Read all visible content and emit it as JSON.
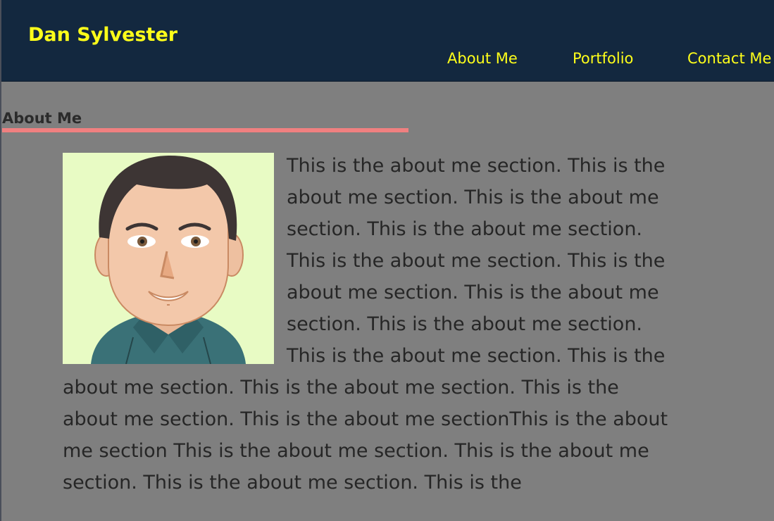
{
  "site": {
    "title": "Dan Sylvester"
  },
  "nav": {
    "items": [
      {
        "label": "About Me"
      },
      {
        "label": "Portfolio"
      },
      {
        "label": "Contact Me"
      }
    ]
  },
  "about": {
    "heading": "About Me",
    "avatar_icon": "cartoon-man-avatar",
    "body": "This is the about me section. This is the about me section. This is the about me section. This is the about me section. This is the about me section. This is the about me section. This is the about me section. This is the about me section. This is the about me section. This is the about me section. This is the about me section. This is the about me section. This is the about me sectionThis is the about me section This is the about me section. This is the about me section. This is the about me section. This is the"
  },
  "colors": {
    "header_bg": "#13283f",
    "accent_text": "#ffff1a",
    "page_bg": "#7f7f7f",
    "heading_rule": "#f08080",
    "avatar_bg": "#e8fbc4"
  }
}
